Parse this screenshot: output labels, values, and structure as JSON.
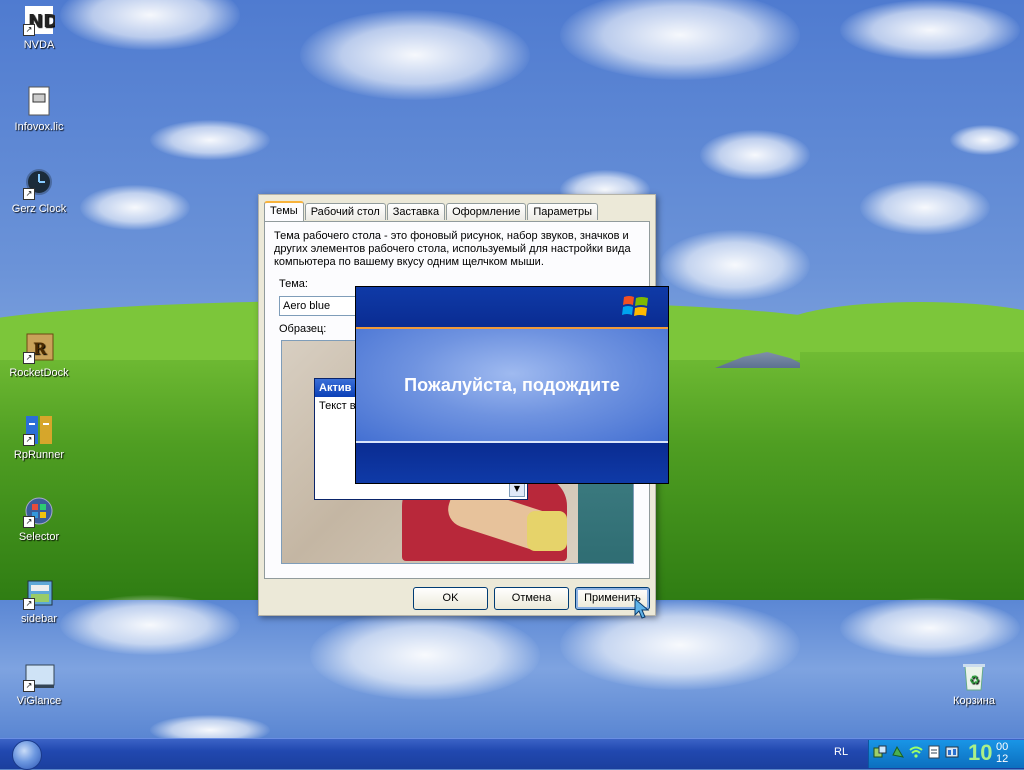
{
  "desktop": {
    "icons": [
      {
        "label": "NVDA",
        "icon": "nvda-icon"
      },
      {
        "label": "Infovox.lic",
        "icon": "document-icon"
      },
      {
        "label": "Gerz Clock",
        "icon": "clock-icon"
      },
      {
        "label": "RocketDock",
        "icon": "rocketdock-icon"
      },
      {
        "label": "RpRunner",
        "icon": "rprunner-icon"
      },
      {
        "label": "Selector",
        "icon": "selector-icon"
      },
      {
        "label": "sidebar",
        "icon": "sidebar-icon"
      },
      {
        "label": "ViGlance",
        "icon": "viglance-icon"
      },
      {
        "label": "Корзина",
        "icon": "recycle-bin-icon"
      }
    ]
  },
  "dialog": {
    "tabs": [
      "Темы",
      "Рабочий стол",
      "Заставка",
      "Оформление",
      "Параметры"
    ],
    "active_tab": "Темы",
    "description": "Тема рабочего стола - это фоновый рисунок, набор звуков, значков и других элементов рабочего стола, используемый для настройки вида компьютера по вашему вкусу одним щелчком мыши.",
    "theme_label": "Тема:",
    "theme_value": "Aero blue",
    "sample_label": "Образец:",
    "preview": {
      "window_title": "Актив",
      "window_text": "Текст в"
    },
    "buttons": {
      "ok": "OK",
      "cancel": "Отмена",
      "apply": "Применить"
    }
  },
  "splash": {
    "message": "Пожалуйста, подождите"
  },
  "taskbar": {
    "language": "RL",
    "clock_hour": "10",
    "clock_minute_top": "00",
    "clock_minute_bottom": "12"
  },
  "colors": {
    "taskbar": "#2148b0",
    "tray": "#0c6fbf",
    "splash": "#0b2e9a",
    "accent": "#f8b33c"
  }
}
